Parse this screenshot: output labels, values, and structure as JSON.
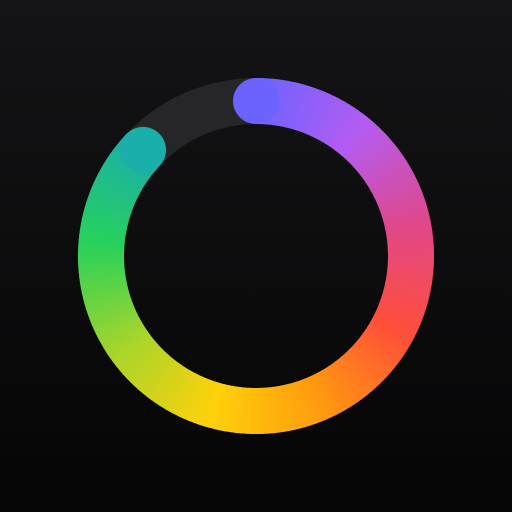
{
  "app_icon": {
    "name": "activity-ring-icon",
    "progress": 0.87,
    "colors": {
      "background_top": "#141416",
      "background_bottom": "#050506",
      "track": "#262628",
      "gradient_stops": [
        "#6C63FF",
        "#B35CF2",
        "#E0488A",
        "#FF4E3A",
        "#FF9A0E",
        "#FFD10B",
        "#A8D52A",
        "#28D25A",
        "#1AAFAA"
      ]
    }
  }
}
